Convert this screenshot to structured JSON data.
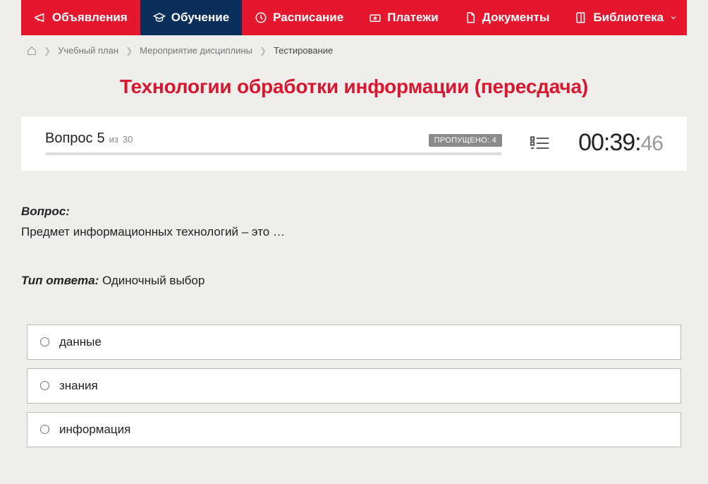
{
  "nav": {
    "items": [
      {
        "label": "Объявления",
        "active": false
      },
      {
        "label": "Обучение",
        "active": true
      },
      {
        "label": "Расписание",
        "active": false
      },
      {
        "label": "Платежи",
        "active": false
      },
      {
        "label": "Документы",
        "active": false
      },
      {
        "label": "Библиотека",
        "active": false,
        "dropdown": true
      }
    ]
  },
  "breadcrumb": {
    "items": [
      {
        "label": "Учебный план"
      },
      {
        "label": "Мероприятие дисциплины"
      },
      {
        "label": "Тестирование",
        "current": true
      }
    ]
  },
  "page_title": "Технологии обработки информации (пересдача)",
  "panel": {
    "question_word": "Вопрос",
    "question_number": "5",
    "question_of_prefix": "из",
    "question_total": "30",
    "skipped_label": "ПРОПУЩЕНО:",
    "skipped_count": "4",
    "timer_main": "00:39:",
    "timer_sub": "46"
  },
  "question": {
    "label": "Вопрос:",
    "text": "Предмет информационных технологий – это …"
  },
  "answer_type": {
    "label": "Тип ответа:",
    "value": "Одиночный выбор"
  },
  "options": [
    {
      "label": "данные"
    },
    {
      "label": "знания"
    },
    {
      "label": "информация"
    }
  ]
}
